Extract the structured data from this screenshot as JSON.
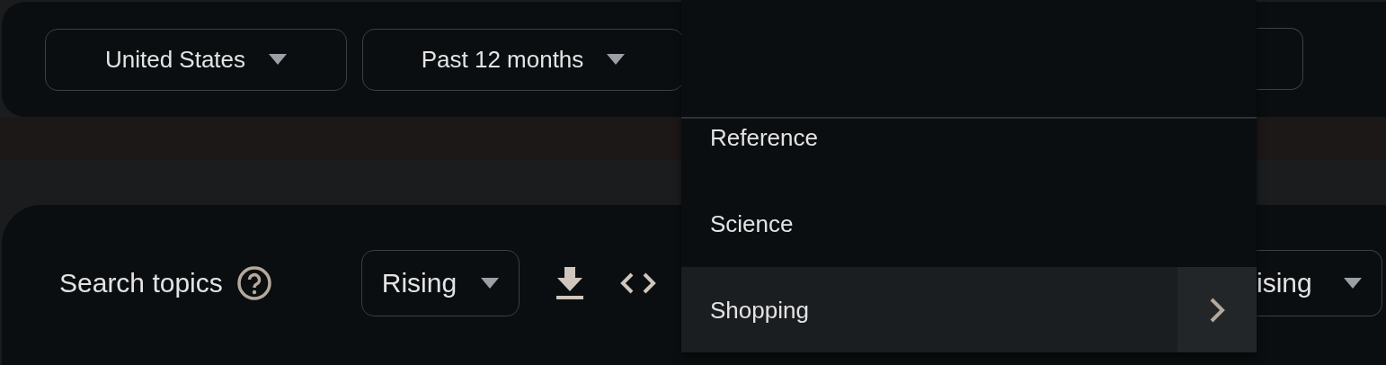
{
  "filters": [
    {
      "label": "United States"
    },
    {
      "label": "Past 12 months"
    }
  ],
  "topics": {
    "title": "Search topics",
    "sort": "Rising",
    "compare_sort": "ising"
  },
  "menu": {
    "items": [
      {
        "label": "Reference",
        "selected": false,
        "submenu": false
      },
      {
        "label": "Science",
        "selected": false,
        "submenu": false
      },
      {
        "label": "Shopping",
        "selected": true,
        "submenu": true
      }
    ]
  }
}
